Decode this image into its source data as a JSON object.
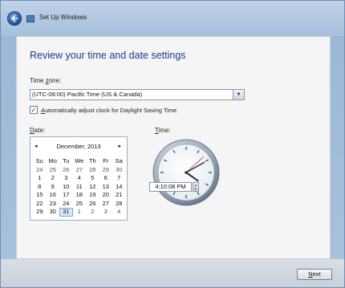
{
  "window": {
    "title": "Set Up Windows"
  },
  "page": {
    "heading": "Review your time and date settings"
  },
  "timezone": {
    "label_prefix": "Time ",
    "label_accel": "z",
    "label_suffix": "one:",
    "value": "(UTC-08:00) Pacific Time (US & Canada)"
  },
  "dst": {
    "checked": true,
    "label_accel": "A",
    "label_rest": "utomatically adjust clock for Daylight Saving Time"
  },
  "date": {
    "label_accel": "D",
    "label_rest": "ate:"
  },
  "time": {
    "label_accel": "T",
    "label_rest": "ime:",
    "value": "4:10:08 PM"
  },
  "calendar": {
    "month_label": "December, 2013",
    "prev_symbol": "◂",
    "next_symbol": "▸",
    "weekdays": [
      "Su",
      "Mo",
      "Tu",
      "We",
      "Th",
      "Fr",
      "Sa"
    ],
    "weeks": [
      [
        "24",
        "25",
        "26",
        "27",
        "28",
        "29",
        "30"
      ],
      [
        "1",
        "2",
        "3",
        "4",
        "5",
        "6",
        "7"
      ],
      [
        "8",
        "9",
        "10",
        "11",
        "12",
        "13",
        "14"
      ],
      [
        "15",
        "16",
        "17",
        "18",
        "19",
        "20",
        "21"
      ],
      [
        "22",
        "23",
        "24",
        "25",
        "26",
        "27",
        "28"
      ],
      [
        "29",
        "30",
        "31",
        "1",
        "2",
        "3",
        "4"
      ]
    ],
    "selected_day": "31"
  },
  "clock": {
    "hours": 4,
    "minutes": 10,
    "seconds": 8
  },
  "footer": {
    "next_accel": "N",
    "next_rest": "ext"
  }
}
